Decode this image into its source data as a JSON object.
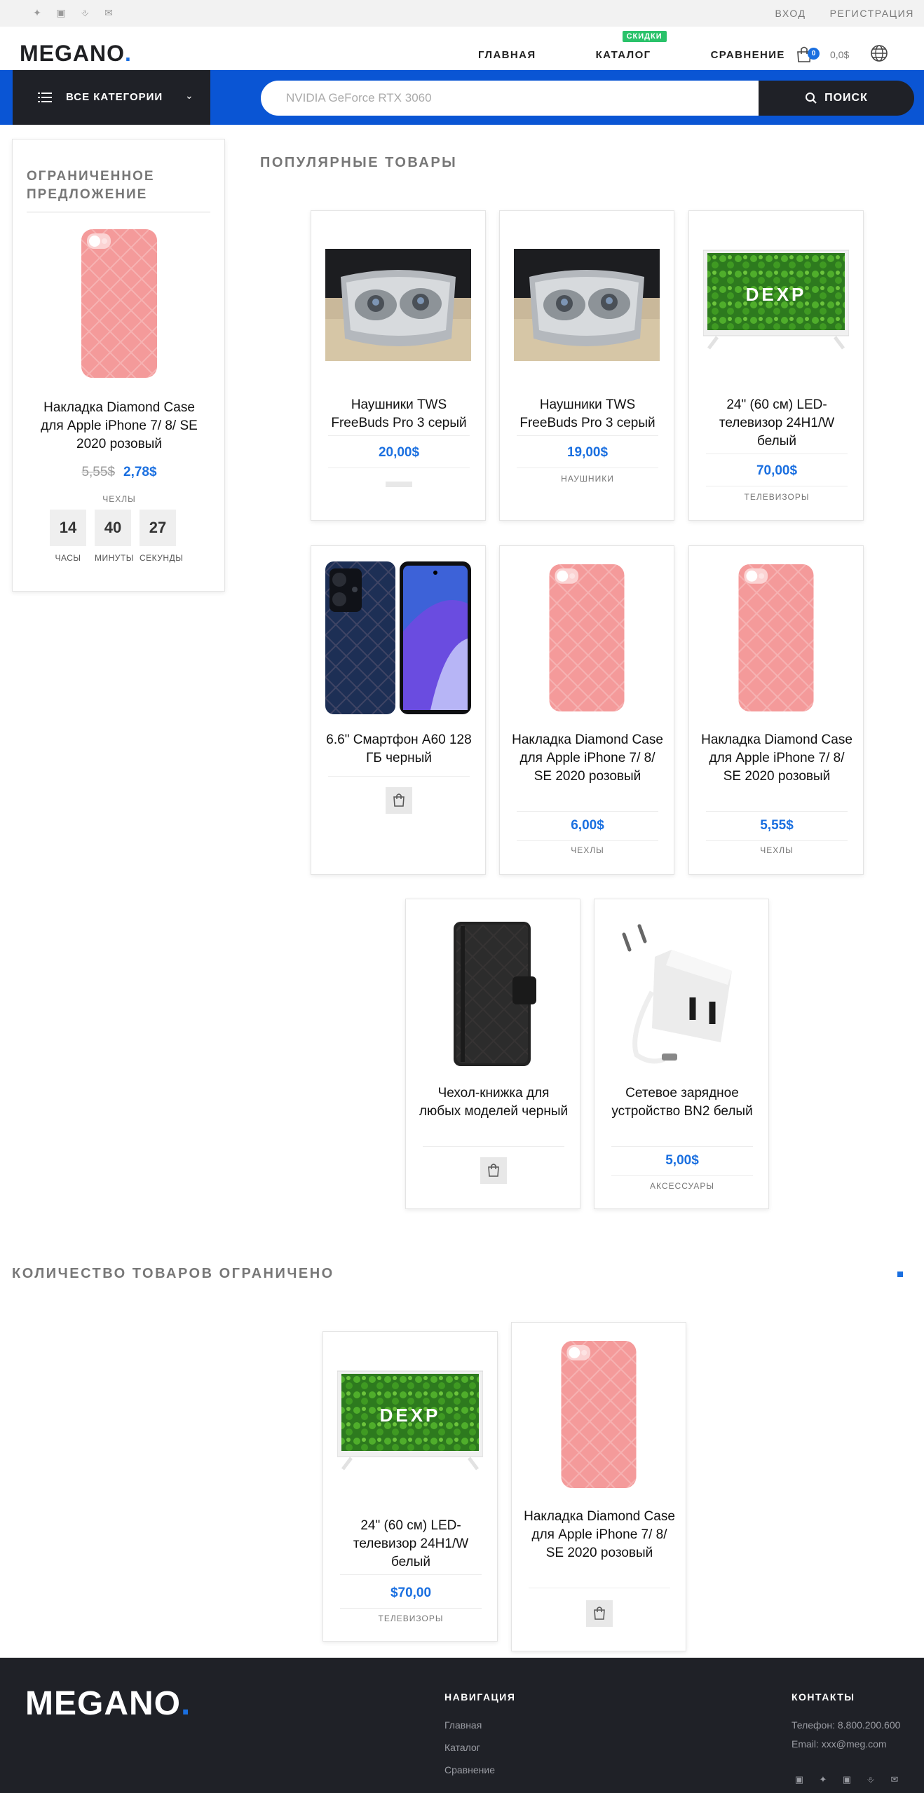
{
  "topbar": {
    "social_icons": [
      "twitter-icon",
      "linkedin-icon",
      "pinterest-icon",
      "mail-icon"
    ],
    "login": "ВХОД",
    "register": "РЕГИСТРАЦИЯ"
  },
  "header": {
    "logo_main": "MEGANO",
    "logo_dot": ".",
    "nav": [
      "ГЛАВНАЯ",
      "КАТАЛОГ",
      "СРАВНЕНИЕ"
    ],
    "sale_badge": "СКИДКИ",
    "cart_count": "0",
    "cart_total": "0,0$"
  },
  "search": {
    "categories_label": "ВСЕ КАТЕГОРИИ",
    "placeholder": "NVIDIA GeForce RTX 3060",
    "button_label": "ПОИСК"
  },
  "offer": {
    "title": "ОГРАНИЧЕННОЕ ПРЕДЛОЖЕНИЕ",
    "product_name": "Накладка Diamond Case для Apple iPhone 7/ 8/ SE 2020 розовый",
    "old_price": "5,55$",
    "new_price": "2,78$",
    "category": "ЧЕХЛЫ",
    "timer": [
      {
        "value": "14",
        "label": "ЧАСЫ"
      },
      {
        "value": "40",
        "label": "МИНУТЫ"
      },
      {
        "value": "27",
        "label": "СЕКУНДЫ"
      }
    ]
  },
  "popular": {
    "title": "ПОПУЛЯРНЫЕ ТОВАРЫ",
    "products": [
      {
        "name": "Наушники TWS FreeBuds Pro 3 серый",
        "price": "20,00$",
        "category": ""
      },
      {
        "name": "Наушники TWS FreeBuds Pro 3 серый",
        "price": "19,00$",
        "category": "НАУШНИКИ"
      },
      {
        "name": "24\" (60 см) LED-телевизор 24H1/W белый",
        "price": "70,00$",
        "category": "ТЕЛЕВИЗОРЫ"
      },
      {
        "name": "6.6\" Смартфон A60 128 ГБ черный",
        "price": "",
        "category": ""
      },
      {
        "name": "Накладка Diamond Case для Apple iPhone 7/ 8/ SE 2020 розовый",
        "price": "6,00$",
        "category": "ЧЕХЛЫ"
      },
      {
        "name": "Накладка Diamond Case для Apple iPhone 7/ 8/ SE 2020 розовый",
        "price": "5,55$",
        "category": "ЧЕХЛЫ"
      },
      {
        "name": "Чехол-книжка для любых моделей черный",
        "price": "",
        "category": ""
      },
      {
        "name": "Сетевое зарядное устройство BN2 белый",
        "price": "5,00$",
        "category": "АКСЕССУАРЫ"
      }
    ]
  },
  "limited": {
    "title": "КОЛИЧЕСТВО ТОВАРОВ ОГРАНИЧЕНО",
    "products": [
      {
        "name": "24\" (60 см) LED-телевизор 24H1/W белый",
        "price": "$70,00",
        "category": "ТЕЛЕВИЗОРЫ"
      },
      {
        "name": "Накладка Diamond Case для Apple iPhone 7/ 8/ SE 2020 розовый",
        "price": "",
        "category": ""
      }
    ]
  },
  "tv_brand": "DEXP",
  "footer": {
    "logo_main": "MEGANO",
    "logo_dot": ".",
    "nav_title": "НАВИГАЦИЯ",
    "nav_links": [
      "Главная",
      "Каталог",
      "Сравнение"
    ],
    "contacts_title": "КОНТАКТЫ",
    "phone": "Телефон: 8.800.200.600",
    "email": "Email: xxx@meg.com",
    "social_icons": [
      "facebook-icon",
      "twitter-icon",
      "linkedin-icon",
      "pinterest-icon",
      "mail-icon"
    ]
  },
  "colors": {
    "accent": "#1a6fe0",
    "dark": "#1f2127",
    "band": "#0a55d4",
    "sale": "#2ac26a"
  }
}
